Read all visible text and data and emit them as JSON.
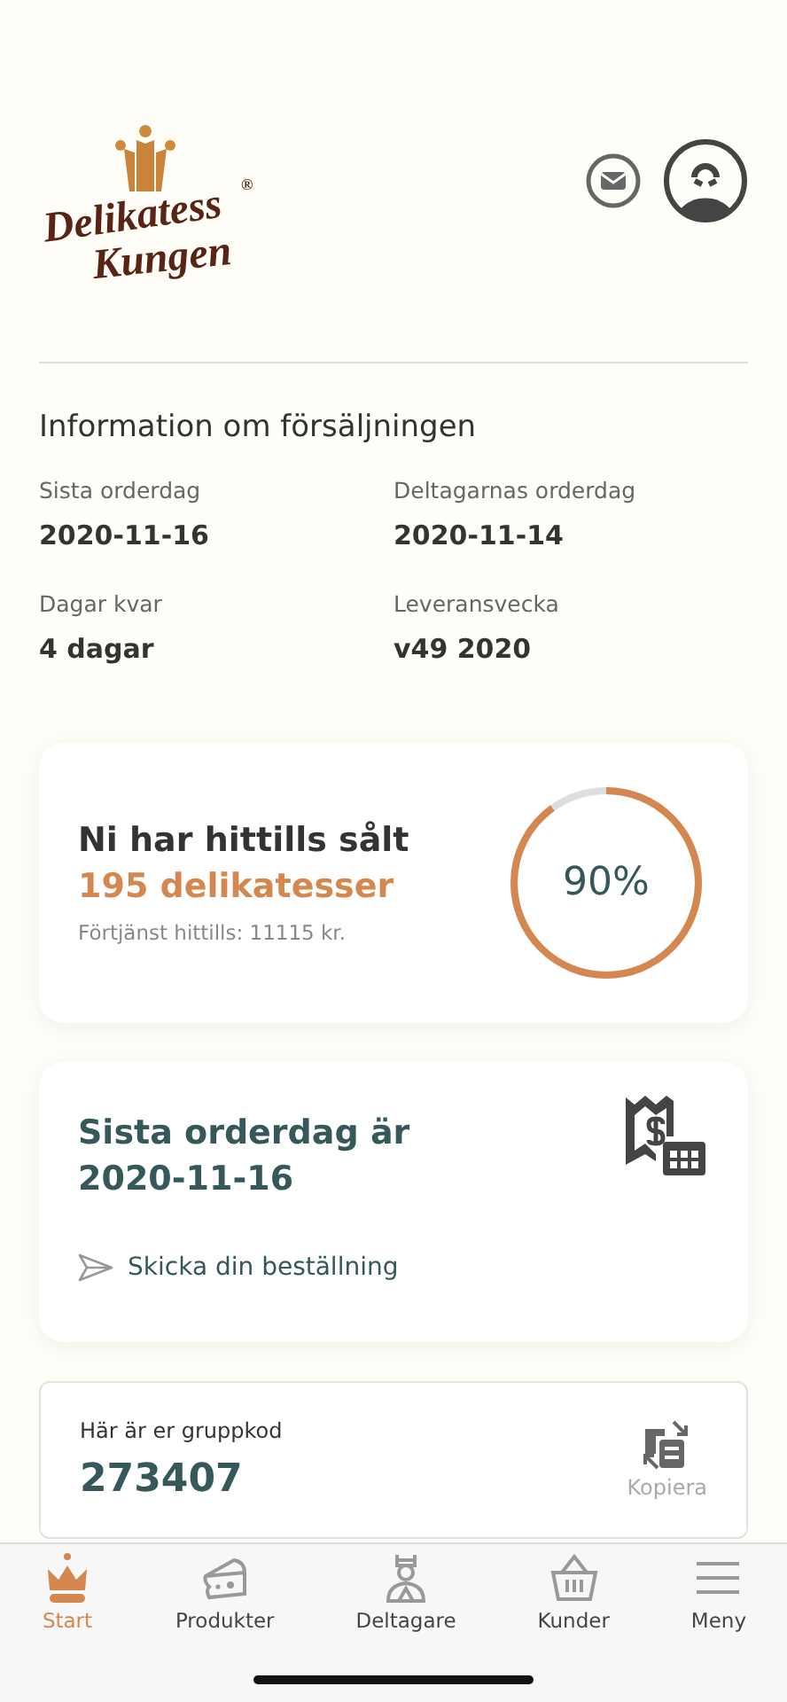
{
  "logo": {
    "line_1": "Delikatess",
    "line_2": "Kungen",
    "mark": "®"
  },
  "sales_info": {
    "title": "Information om försäljningen",
    "fields": [
      {
        "label": "Sista orderdag",
        "value": "2020-11-16"
      },
      {
        "label": "Deltagarnas orderdag",
        "value": "2020-11-14"
      },
      {
        "label": "Dagar kvar",
        "value": "4 dagar"
      },
      {
        "label": "Leveransvecka",
        "value": "v49 2020"
      }
    ]
  },
  "sold_card": {
    "heading": "Ni har hittills sålt",
    "amount": "195 delikatesser",
    "earnings": "Förtjänst hittills: 11115 kr.",
    "progress_text": "90%",
    "level": 0.9
  },
  "deadline_card": {
    "heading_line_1": "Sista orderdag är",
    "heading_line_2": "2020-11-16",
    "link": "Skicka din beställning"
  },
  "group_code_card": {
    "label": "Här är er gruppkod",
    "code": "273407",
    "copy_label": "Kopiera"
  },
  "tab_bar": [
    {
      "label": "Start",
      "kind": "crown",
      "selected": true
    },
    {
      "label": "Produkter",
      "kind": "cheese",
      "selected": false
    },
    {
      "label": "Deltagare",
      "kind": "person",
      "selected": false
    },
    {
      "label": "Kunder",
      "kind": "basket",
      "selected": false
    },
    {
      "label": "Meny",
      "kind": "menu",
      "selected": false
    }
  ]
}
